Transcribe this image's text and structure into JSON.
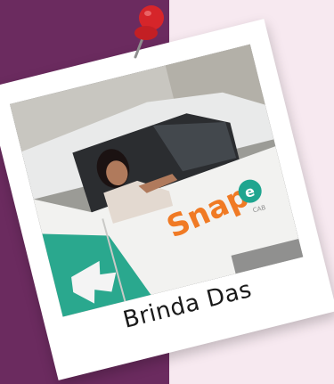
{
  "caption": {
    "name": "Brinda Das"
  },
  "photo": {
    "car_logo_text": "Snap",
    "car_logo_mark": "e",
    "car_sub_text": "CAB"
  },
  "icons": {
    "pin": "push-pin-icon"
  },
  "colors": {
    "left_panel": "#6b2b5f",
    "right_panel": "#f7e9f0",
    "polaroid": "#ffffff",
    "pin_red": "#d6252a",
    "snap_orange": "#f07a24",
    "snap_teal": "#1fa58f",
    "car_teal": "#2aa88e"
  }
}
